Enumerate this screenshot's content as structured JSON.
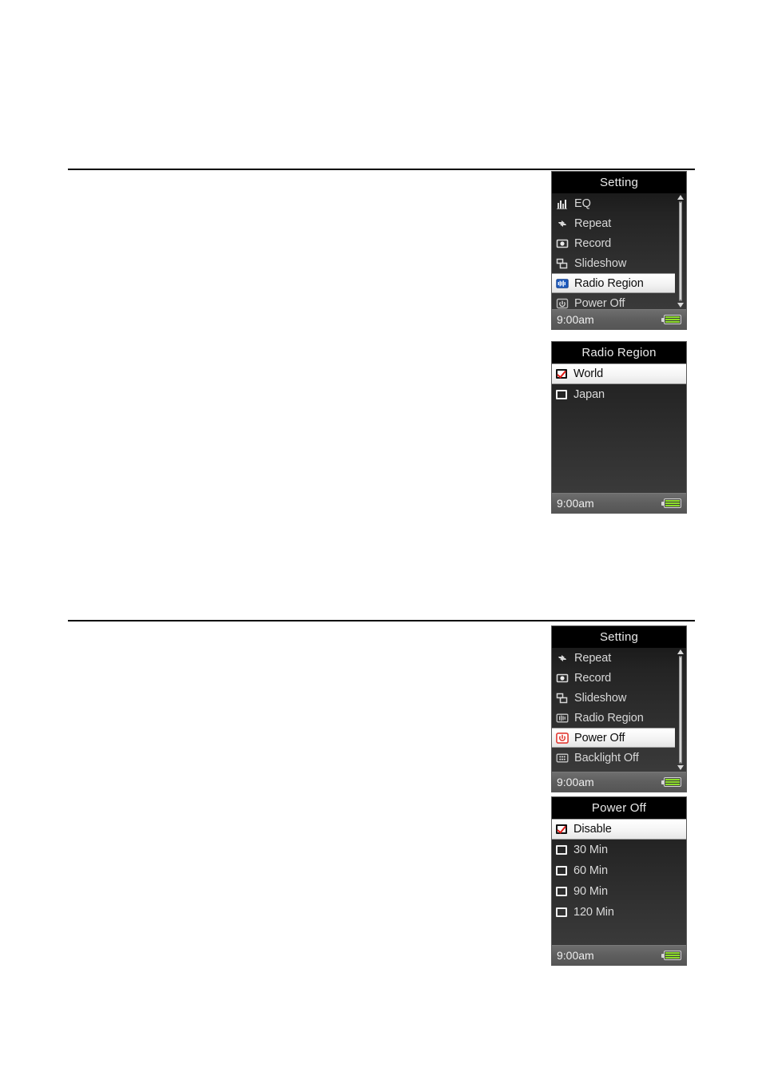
{
  "page": {
    "rules": [
      "top-rule",
      "bottom-rule"
    ]
  },
  "screens": [
    {
      "id": "setting-1",
      "title": "Setting",
      "type": "icon-menu",
      "items": [
        {
          "icon": "equalizer-icon",
          "label": "EQ",
          "selected": false
        },
        {
          "icon": "repeat-icon",
          "label": "Repeat",
          "selected": false
        },
        {
          "icon": "record-icon",
          "label": "Record",
          "selected": false
        },
        {
          "icon": "slideshow-icon",
          "label": "Slideshow",
          "selected": false
        },
        {
          "icon": "radio-region-icon",
          "label": "Radio Region",
          "selected": true
        },
        {
          "icon": "power-off-icon",
          "label": "Power Off",
          "selected": false
        }
      ],
      "scrollbar": {
        "visible": true,
        "thumb_top_pct": 2,
        "thumb_height_pct": 96
      },
      "status": {
        "time": "9:00am",
        "battery": "battery-full-icon"
      }
    },
    {
      "id": "radio-region",
      "title": "Radio Region",
      "type": "checkbox-list",
      "items": [
        {
          "label": "World",
          "checked": true,
          "selected": true
        },
        {
          "label": "Japan",
          "checked": false,
          "selected": false
        }
      ],
      "scrollbar": {
        "visible": false
      },
      "status": {
        "time": "9:00am",
        "battery": "battery-full-icon"
      }
    },
    {
      "id": "setting-2",
      "title": "Setting",
      "type": "icon-menu",
      "items": [
        {
          "icon": "repeat-icon",
          "label": "Repeat",
          "selected": false
        },
        {
          "icon": "record-icon",
          "label": "Record",
          "selected": false
        },
        {
          "icon": "slideshow-icon",
          "label": "Slideshow",
          "selected": false
        },
        {
          "icon": "radio-region-icon",
          "label": "Radio Region",
          "selected": false
        },
        {
          "icon": "power-off-red-icon",
          "label": "Power Off",
          "selected": true
        },
        {
          "icon": "backlight-off-icon",
          "label": "Backlight Off",
          "selected": false
        }
      ],
      "scrollbar": {
        "visible": true,
        "thumb_top_pct": 4,
        "thumb_height_pct": 92
      },
      "status": {
        "time": "9:00am",
        "battery": "battery-full-icon"
      }
    },
    {
      "id": "power-off",
      "title": "Power Off",
      "type": "checkbox-list",
      "items": [
        {
          "label": "Disable",
          "checked": true,
          "selected": true
        },
        {
          "label": "30 Min",
          "checked": false,
          "selected": false
        },
        {
          "label": "60 Min",
          "checked": false,
          "selected": false
        },
        {
          "label": "90 Min",
          "checked": false,
          "selected": false
        },
        {
          "label": "120 Min",
          "checked": false,
          "selected": false
        }
      ],
      "scrollbar": {
        "visible": false
      },
      "status": {
        "time": "9:00am",
        "battery": "battery-full-icon"
      }
    }
  ],
  "colors": {
    "title_bar": "#000000",
    "selected_row": "#ffffff",
    "menu_text": "#d8d8d8",
    "status_bar": "#5e5e5e",
    "battery_green": "#8ddd2a",
    "check_red": "#e01b16",
    "radio_icon_blue": "#2b6fd4",
    "power_icon_red": "#e23b33"
  }
}
